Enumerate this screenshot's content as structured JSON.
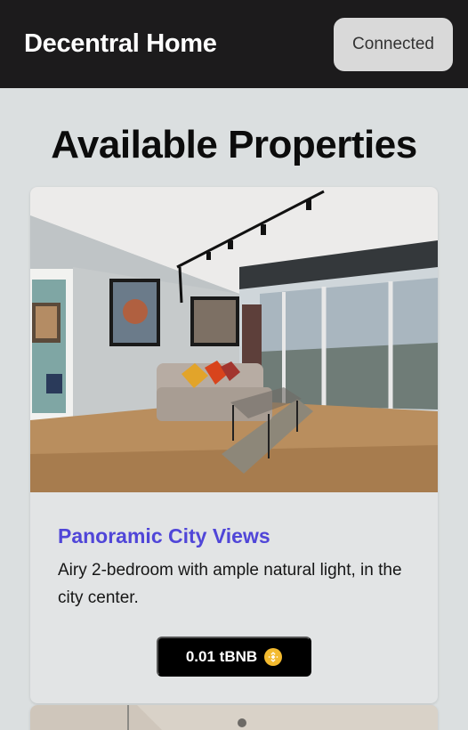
{
  "header": {
    "brand": "Decentral Home",
    "wallet_status": "Connected"
  },
  "main": {
    "title": "Available Properties",
    "properties": [
      {
        "title": "Panoramic City Views",
        "description": "Airy 2-bedroom with ample natural light, in the city center.",
        "price": "0.01 tBNB",
        "price_icon": "bnb-coin-icon",
        "image": "living-room-photo"
      },
      {
        "image": "apartment-photo-partial"
      }
    ]
  },
  "colors": {
    "header_bg": "#1c1b1c",
    "page_bg": "#dbdfe0",
    "accent_title": "#5046d8",
    "price_bg": "#000000",
    "bnb_gold": "#f3ba2f"
  }
}
